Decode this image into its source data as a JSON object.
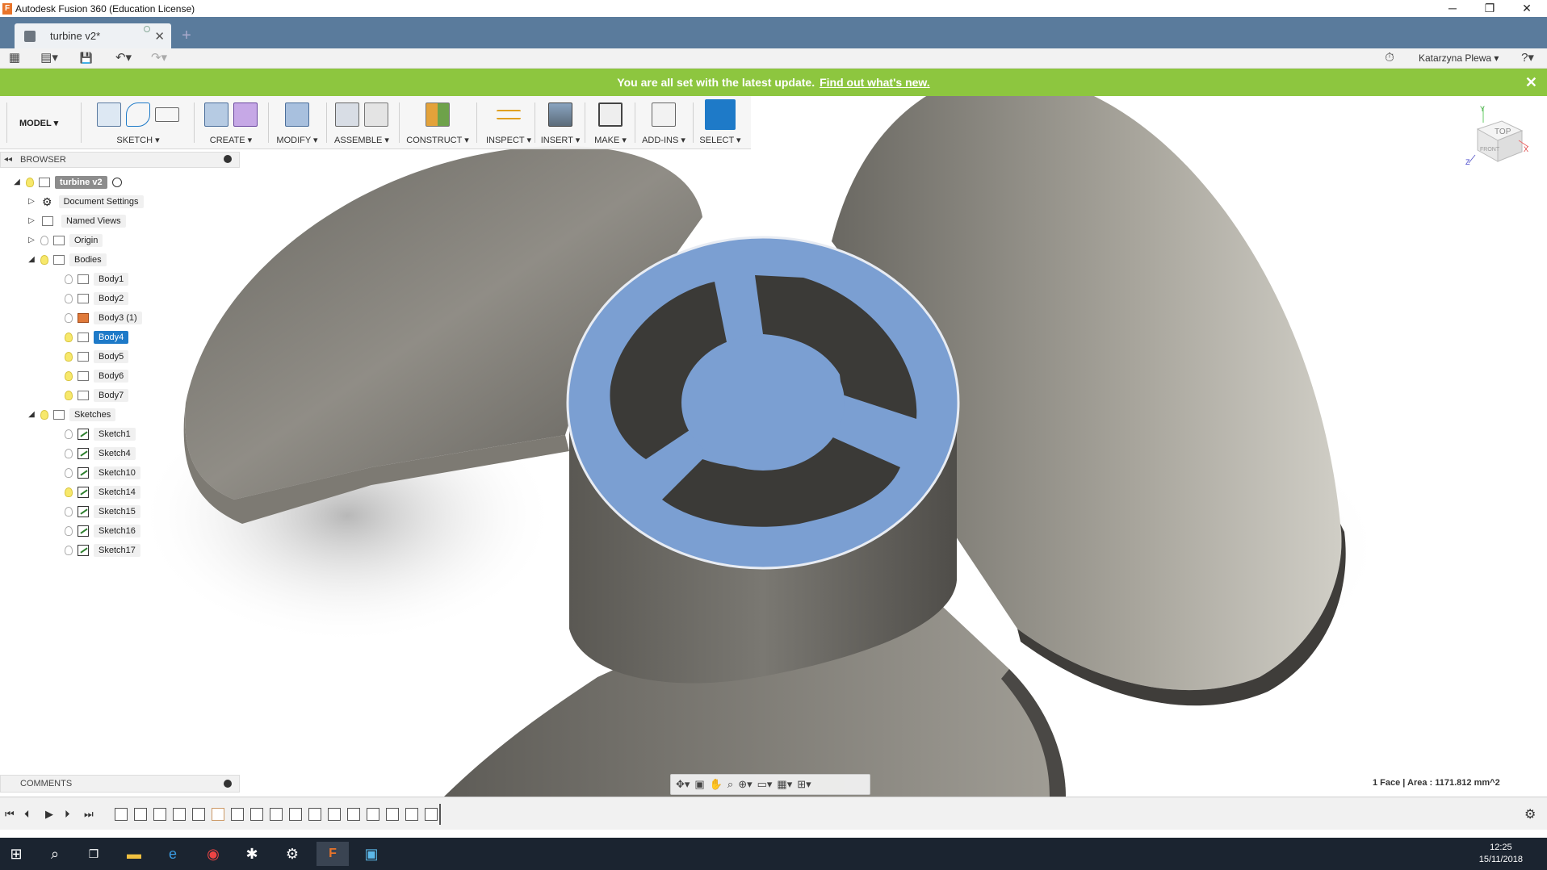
{
  "window": {
    "title": "Autodesk Fusion 360 (Education License)",
    "minimize": "─",
    "restore": "❐",
    "close": "✕"
  },
  "tab": {
    "label": "turbine v2*",
    "close": "✕",
    "new": "+"
  },
  "qat": {
    "grid": "▦",
    "file": "▤▾",
    "save": "💾",
    "undo": "↶▾",
    "redo": "↷▾",
    "history": "⏱",
    "user": "Katarzyna Plewa ▾",
    "help": "?▾"
  },
  "banner": {
    "text": "You are all set with the latest update.",
    "link": "Find out what's new.",
    "close": "✕"
  },
  "toolbar": {
    "workspace": "MODEL ▾",
    "groups": [
      "SKETCH ▾",
      "CREATE ▾",
      "MODIFY ▾",
      "ASSEMBLE ▾",
      "CONSTRUCT ▾",
      "INSPECT ▾",
      "INSERT ▾",
      "MAKE ▾",
      "ADD-INS ▾",
      "SELECT ▾"
    ]
  },
  "browser": {
    "title": "BROWSER",
    "collapse": "◂◂",
    "root": "turbine v2",
    "items": {
      "document_settings": "Document Settings",
      "named_views": "Named Views",
      "origin": "Origin",
      "bodies": "Bodies",
      "sketches": "Sketches"
    },
    "bodies": [
      "Body1",
      "Body2",
      "Body3 (1)",
      "Body4",
      "Body5",
      "Body6",
      "Body7"
    ],
    "sketches": [
      "Sketch1",
      "Sketch4",
      "Sketch10",
      "Sketch14",
      "Sketch15",
      "Sketch16",
      "Sketch17"
    ],
    "expand_open": "◢",
    "expand_closed": "▷"
  },
  "viewcube": {
    "top": "TOP",
    "front": "FRONT",
    "x": "X",
    "y": "Y",
    "z": "Z"
  },
  "comments": {
    "title": "COMMENTS"
  },
  "status": {
    "text": "1 Face | Area : 1171.812 mm^2"
  },
  "timeline": {
    "first": "⏮",
    "prev": "⏴",
    "play": "▶",
    "next": "⏵",
    "last": "⏭",
    "settings": "⚙"
  },
  "taskbar": {
    "time": "12:25",
    "date": "15/11/2018"
  },
  "colors": {
    "accent": "#1e7ac8",
    "banner": "#8dc63f",
    "tabbar": "#5a7b9c",
    "selection_face": "#7b9fd2",
    "model": "#8a8880"
  }
}
